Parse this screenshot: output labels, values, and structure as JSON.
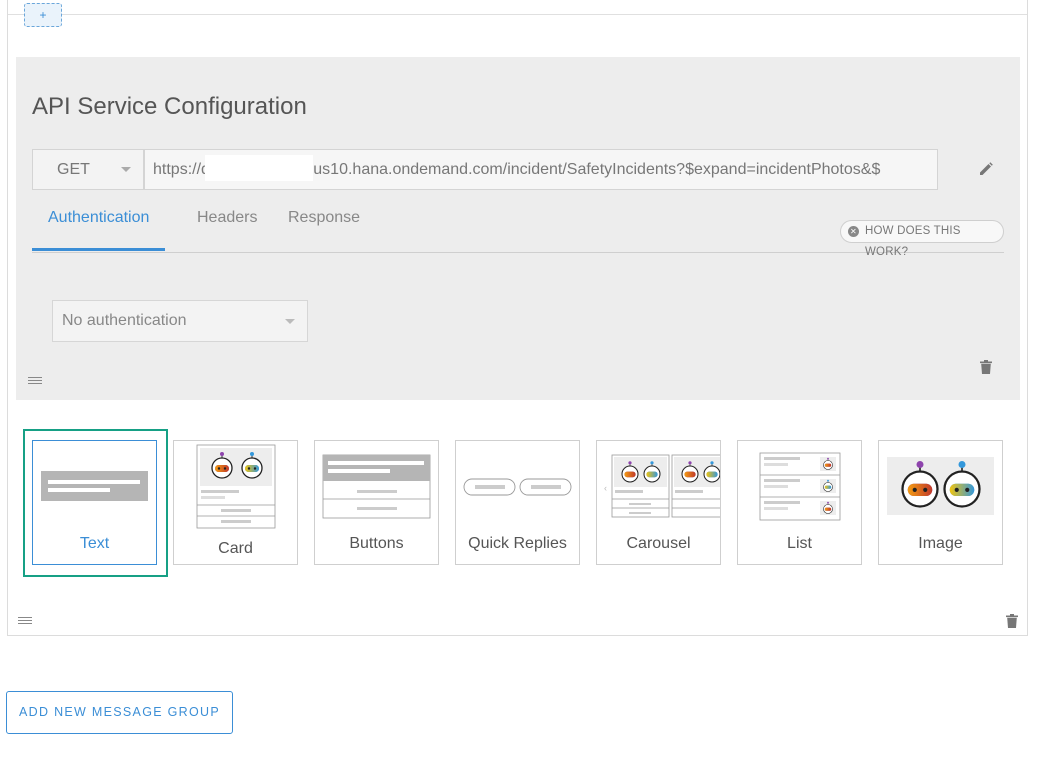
{
  "top_add_button": {
    "label": "+"
  },
  "api_config": {
    "title": "API Service Configuration",
    "method": "GET",
    "url_prefix": "https://da",
    "url_suffix": ".us10.hana.ondemand.com/incident/SafetyIncidents?$expand=incidentPhotos&$",
    "tabs": [
      {
        "label": "Authentication",
        "active": true
      },
      {
        "label": "Headers",
        "active": false
      },
      {
        "label": "Response",
        "active": false
      }
    ],
    "help_button": "HOW DOES THIS WORK?",
    "auth_select": "No authentication"
  },
  "message_types": [
    {
      "label": "Text",
      "selected": true
    },
    {
      "label": "Card",
      "selected": false
    },
    {
      "label": "Buttons",
      "selected": false
    },
    {
      "label": "Quick Replies",
      "selected": false
    },
    {
      "label": "Carousel",
      "selected": false
    },
    {
      "label": "List",
      "selected": false
    },
    {
      "label": "Image",
      "selected": false
    }
  ],
  "add_message_group": "ADD NEW MESSAGE GROUP",
  "colors": {
    "accent": "#3b8ed6",
    "selected_outline": "#16a085",
    "panel_bg": "#ededed"
  }
}
